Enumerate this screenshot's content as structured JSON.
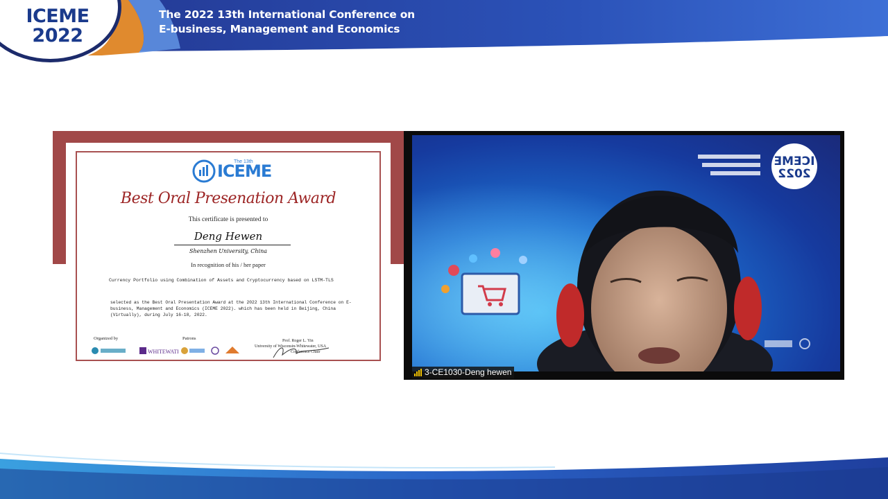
{
  "header": {
    "logo_line1": "ICEME",
    "logo_line2": "2022",
    "title_line1": "The 2022 13th International Conference on",
    "title_line2": "E-business, Management and Economics"
  },
  "certificate": {
    "logo_text": "ICEME",
    "logo_sub": "The 13th",
    "award_title": "Best Oral Presenation Award",
    "presented_to": "This  certificate is presented to",
    "recipient": "Deng Hewen",
    "affiliation": "Shenzhen University, China",
    "recognition": "In recognition of his / her paper",
    "paper_title": "Currency Portfolio using Combination of Assets and Cryptocurrency based on LSTM-TLS",
    "selected_text": "selected as the Best Oral Presentation Award at the 2022 13th International Conference on E-business, Management and Economics (ICEME 2022). which has been held in Beijing, China (Virtually), during July 16-18, 2022.",
    "organized_by": "Organized by",
    "patrons": "Patrons",
    "chair_name": "Prof. Roger L. Yin",
    "chair_affiliation": "University of Wisconsin-Whitewater, USA",
    "chair_role": "Conference Chair",
    "sponsor_whitewater": "WHITEWATER"
  },
  "video": {
    "participant_label": "3-CE1030-Deng hewen",
    "bg_logo_line1": "ICEME",
    "bg_logo_line2": "2022"
  },
  "colors": {
    "banner_blue": "#2a3f9e",
    "banner_accent": "#e08a2e",
    "certificate_red": "#a14848",
    "name_tag_signal": "#f5c400"
  }
}
